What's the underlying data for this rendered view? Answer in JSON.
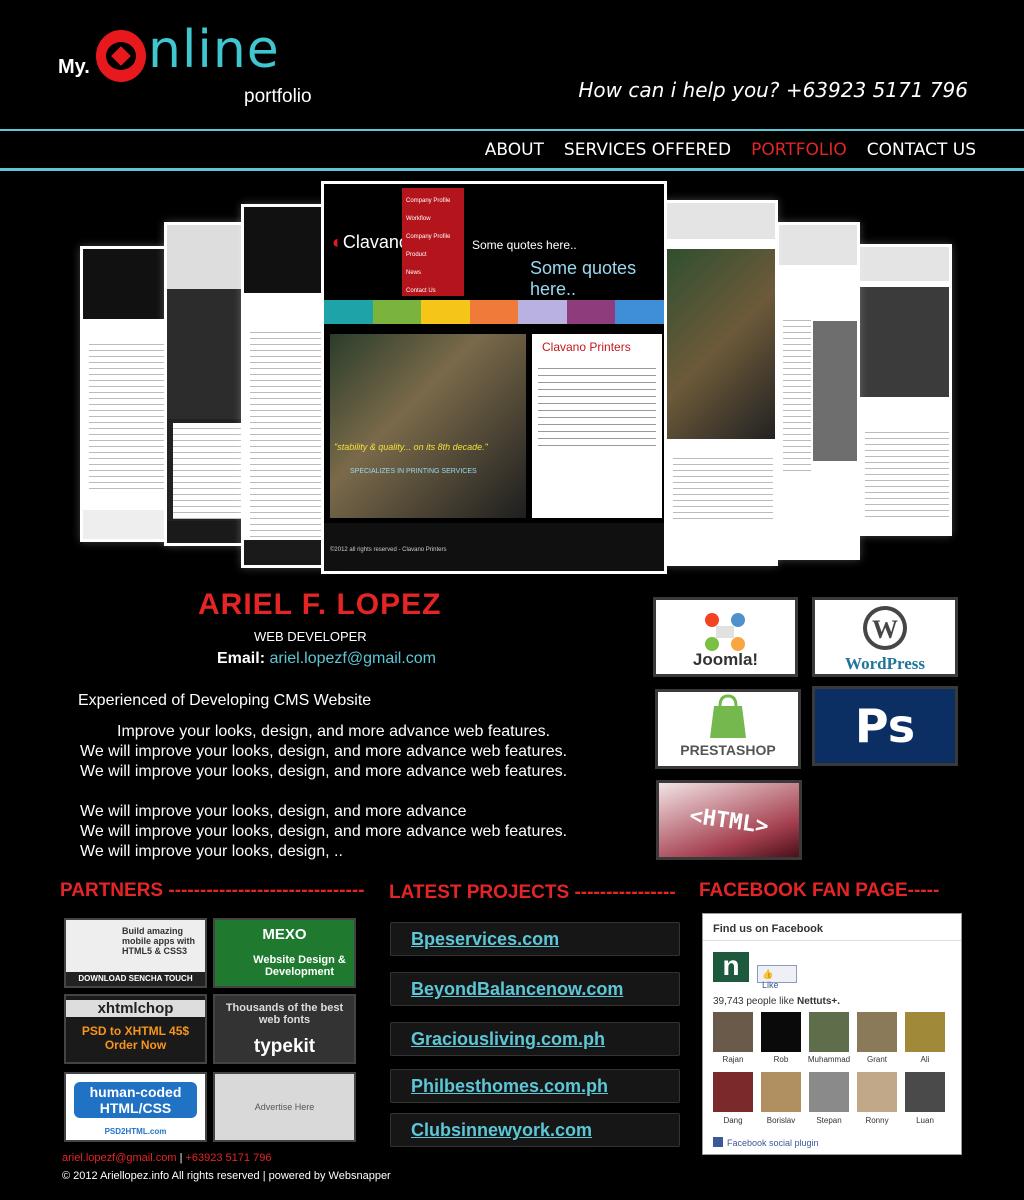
{
  "header": {
    "logo_my": "My.",
    "logo_main": "nline",
    "logo_sub": "portfolio",
    "helpline": "How can i  help you?  +63923 5171 796"
  },
  "nav": {
    "items": [
      {
        "label": "ABOUT",
        "active": false
      },
      {
        "label": "SERVICES OFFERED",
        "active": false
      },
      {
        "label": "PORTFOLIO",
        "active": true
      },
      {
        "label": "CONTACT US",
        "active": false
      }
    ],
    "active_color": "#e52525"
  },
  "showcase": {
    "main": {
      "logo": "Clavano",
      "logo_sub": "Printers",
      "menu": [
        "Company Profile",
        "Workflow",
        "Company Profile",
        "Product",
        "News",
        "Contact Us"
      ],
      "quote_small": "Some quotes here..",
      "quote_big": "Some quotes here..",
      "bar_colors": [
        "#1ea3a8",
        "#7ab43c",
        "#f5c518",
        "#f07a3a",
        "#b9b2e0",
        "#8e3c7c",
        "#3f8fd8"
      ],
      "image_quote": "\"stability & quality... on its 8th decade.\"",
      "image_sub": "SPECIALIZES IN PRINTING SERVICES",
      "right_title": "Clavano Printers",
      "footer": "©2012 all rights reserved - Clavano Printers"
    }
  },
  "profile": {
    "name": "ARIEL F. LOPEZ",
    "role": "WEB DEVELOPER",
    "email_label": "Email:",
    "email": "ariel.lopezf@gmail.com",
    "experience": "Experienced of Developing CMS Website",
    "lines1": [
      "Improve your looks, design, and more advance web features.",
      "We will improve your looks, design, and more advance web features.",
      "We will improve your looks, design, and more advance web features."
    ],
    "lines2": [
      "We will improve your looks, design, and more advance",
      "We will improve your looks, design, and more advance web features.",
      "We will improve your looks, design, .."
    ]
  },
  "tech": {
    "joomla": "Joomla!",
    "wordpress": "WordPress",
    "prestashop": "PRESTASHOP",
    "photoshop": "Ps",
    "html": "<HTML>"
  },
  "sections": {
    "partners": "PARTNERS -------------------------------",
    "projects": "LATEST PROJECTS ----------------",
    "facebook": "FACEBOOK FAN PAGE-----"
  },
  "partners": [
    {
      "top": "Build amazing mobile apps with HTML5 & CSS3",
      "bottom": "DOWNLOAD SENCHA TOUCH"
    },
    {
      "top": "MEXO",
      "bottom": "Website Design & Development"
    },
    {
      "top": "xhtmlchop",
      "bottom": "PSD to XHTML 45$ Order Now"
    },
    {
      "top": "Thousands of the best web fonts",
      "bottom": "typekit"
    },
    {
      "top": "human-coded HTML/CSS",
      "bottom": "PSD2HTML.com"
    },
    {
      "top": "Advertise Here",
      "bottom": "Advertise Here"
    }
  ],
  "projects": [
    "Bpeservices.com",
    "BeyondBalancenow.com",
    "Graciousliving.com.ph",
    "Philbesthomes.com.ph",
    "Clubsinnewyork.com"
  ],
  "facebook": {
    "title": "Find us on Facebook",
    "page_initial": "n",
    "like": "Like",
    "count": "39,743 people like",
    "page_name": "Nettuts+.",
    "fans": [
      "Rajan",
      "Rob",
      "Muhammad",
      "Grant",
      "Ali",
      "Dang",
      "Borislav",
      "Stepan",
      "Ronny",
      "Luan"
    ],
    "plugin": "Facebook social plugin"
  },
  "footer": {
    "email": "ariel.lopezf@gmail.com",
    "sep": "|",
    "phone": "+63923 5171 796",
    "copyright": "© 2012 Ariellopez.info  All rights reserved | powered by Websnapper"
  }
}
